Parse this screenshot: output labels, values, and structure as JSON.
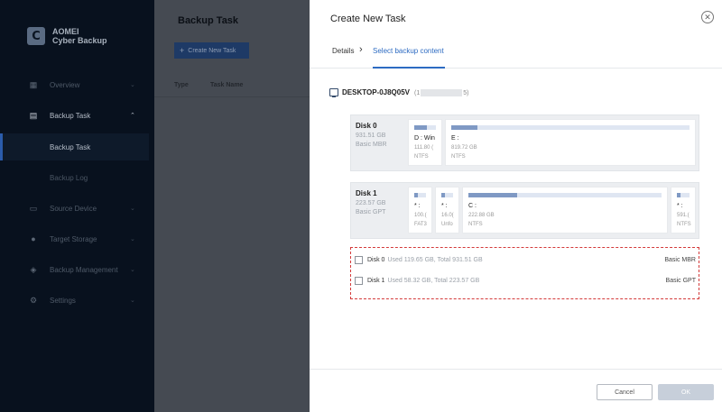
{
  "sidebar": {
    "brand_line1": "AOMEI",
    "brand_line2": "Cyber Backup",
    "logo_letter": "C",
    "items": [
      {
        "label": "Overview",
        "icon": "overview-icon"
      },
      {
        "label": "Backup Task",
        "icon": "backup-task-icon"
      },
      {
        "label": "Backup Task"
      },
      {
        "label": "Backup Log"
      },
      {
        "label": "Source Device",
        "icon": "monitor-icon"
      },
      {
        "label": "Target Storage",
        "icon": "location-pin-icon"
      },
      {
        "label": "Backup Management",
        "icon": "layers-icon"
      },
      {
        "label": "Settings",
        "icon": "gear-icon"
      }
    ]
  },
  "middle": {
    "title": "Backup Task",
    "create_button": "Create New Task",
    "col_type": "Type",
    "col_name": "Task Name"
  },
  "dialog": {
    "title": "Create New Task",
    "step1": "Details",
    "step2": "Select backup content",
    "computer_name": "DESKTOP-0J8Q05V",
    "computer_id_open": "(1",
    "computer_id_close": "5)",
    "disks": [
      {
        "name": "Disk 0",
        "size": "931.51 GB",
        "type": "Basic MBR",
        "partitions": [
          {
            "label": "D : Win",
            "size": "111.80 (",
            "fs": "NTFS",
            "used": 0.6
          },
          {
            "label": "E :",
            "size": "819.72 GB",
            "fs": "NTFS",
            "used": 0.11
          }
        ]
      },
      {
        "name": "Disk 1",
        "size": "223.57 GB",
        "type": "Basic GPT",
        "partitions": [
          {
            "label": "* :",
            "size": "100.(",
            "fs": "FAT3",
            "used": 0.3
          },
          {
            "label": "* :",
            "size": "16.0(",
            "fs": "Unfo",
            "used": 0.3
          },
          {
            "label": "C :",
            "size": "222.88 GB",
            "fs": "NTFS",
            "used": 0.25
          },
          {
            "label": "* :",
            "size": "591.(",
            "fs": "NTFS",
            "used": 0.3
          }
        ]
      }
    ],
    "select_rows": [
      {
        "name": "Disk 0",
        "detail": "Used 119.65 GB, Total 931.51 GB",
        "type": "Basic MBR"
      },
      {
        "name": "Disk 1",
        "detail": "Used 58.32 GB, Total 223.57 GB",
        "type": "Basic GPT"
      }
    ],
    "cancel_label": "Cancel",
    "ok_label": "OK"
  }
}
